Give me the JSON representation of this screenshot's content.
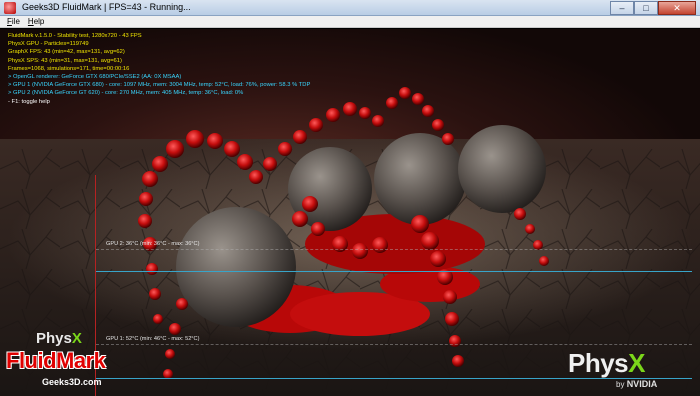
{
  "window": {
    "title": "Geeks3D FluidMark | FPS=43 - Running...",
    "controls": {
      "minimize": "–",
      "maximize": "□",
      "close": "✕"
    }
  },
  "menu": [
    {
      "key": "F",
      "rest": "ile"
    },
    {
      "key": "H",
      "rest": "elp"
    }
  ],
  "hud_lines": [
    {
      "text": "FluidMark v.1.5.0 - Stability test, 1280x720 - 43 FPS",
      "color": "yellow"
    },
    {
      "text": "PhysX GPU - Particles=119749",
      "color": "yellow"
    },
    {
      "text": "GraphX FPS: 43 (min=42, max=131, avg=62)",
      "color": "yellow"
    },
    {
      "text": "PhysX SPS: 43 (min=31, max=131, avg=61)",
      "color": "yellow"
    },
    {
      "text": "Frames=1068, simulations=171, time=00:00:16",
      "color": "yellow"
    },
    {
      "text": "> OpenGL renderer: GeForce GTX 680/PCIe/SSE2 (AA: 0X MSAA)",
      "color": "cyan"
    },
    {
      "text": "> GPU 1 (NVIDIA GeForce GTX 680) - core: 1097 MHz, mem: 3004 MHz, temp: 52°C, load: 76%, power: 58.3 % TDP",
      "color": "cyan"
    },
    {
      "text": "> GPU 2 (NVIDIA GeForce GT 620) - core: 270 MHz, mem: 405 MHz, temp: 36°C, load: 0%",
      "color": "cyan"
    },
    {
      "text": "- F1: toggle help",
      "color": "white"
    }
  ],
  "graphs": {
    "gpu2_label": "GPU 2: 36°C (min: 36°C - max: 36°C)",
    "gpu1_label": "GPU 1: 52°C (min: 46°C - max: 52°C)"
  },
  "logos": {
    "physx_small_a": "Phys",
    "physx_small_b": "X",
    "fluidmark": "FluidMark",
    "geeks3d": "Geeks3D.com",
    "physx_big_a": "Phys",
    "physx_big_b": "X",
    "nvidia_by": "by",
    "nvidia_name": "NVIDIA"
  },
  "colors": {
    "hud_yellow": "#f2e600",
    "hud_cyan": "#39d6ff",
    "fluid_red": "#c40d0d",
    "graph_line": "#38a4c8",
    "physx_green": "#7bd61a"
  }
}
